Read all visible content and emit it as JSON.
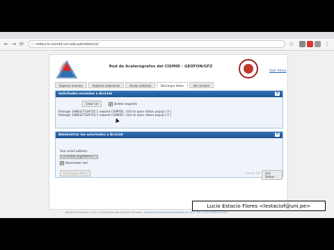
{
  "browser": {
    "url": "redaccis.cismid.uni.edu.pe/redaccis/",
    "nav_back": "←",
    "nav_forward": "→",
    "nav_reload": "⟳",
    "star": "☆"
  },
  "header": {
    "logo_text": "CISMID",
    "site_title": "Red de Acelerógrafos del CISMID - GEOFON/GFZ",
    "logout_label": "Salir Ahora"
  },
  "tabs": [
    {
      "label": "Explorar eventos"
    },
    {
      "label": "Explorar estaciones"
    },
    {
      "label": "Enviar solicitud"
    },
    {
      "label": "Descargar datos"
    },
    {
      "label": "Ver consola"
    }
  ],
  "panel1": {
    "title": "Solicitudes enviadas a ArcLink",
    "toggle": "⊟",
    "clear_button": "Clear list",
    "delete_label": "Delete requests",
    "packages": [
      {
        "text": "Package 1488327329755.1 request CISMIDC; click to open status popup",
        "bracket": "[ X ]"
      },
      {
        "text": "Package 1488327329755.1 request CISMIDC; click to open status popup",
        "bracket": "[ X ]"
      }
    ]
  },
  "panel2": {
    "title": "Administrar las solicitudes a ArcLink",
    "toggle": "⊟",
    "email_label": "Your email address",
    "email_value": "lucioestacio@hotmail.com",
    "remember_label": "Remember me!",
    "left_button": "Descargar datos",
    "right_button1": "Cerrar OK",
    "right_button2": "Get Status"
  },
  "footer": {
    "text": "WebDC3 Interface © 2013-2016 Helmholtz-Zentrum Potsdam ·",
    "link1": "Deutsches GeoForschungsZentrum GFZ",
    "link2": "EIV 1.0.31 (2016-11-19)"
  },
  "caption": {
    "text": "Lucio Estacio Flores <lestaciof@uni.pe>"
  },
  "colors": {
    "panel_header": "#1f5695",
    "logo_red": "#d62828",
    "logo_blue": "#2f6fb2"
  }
}
